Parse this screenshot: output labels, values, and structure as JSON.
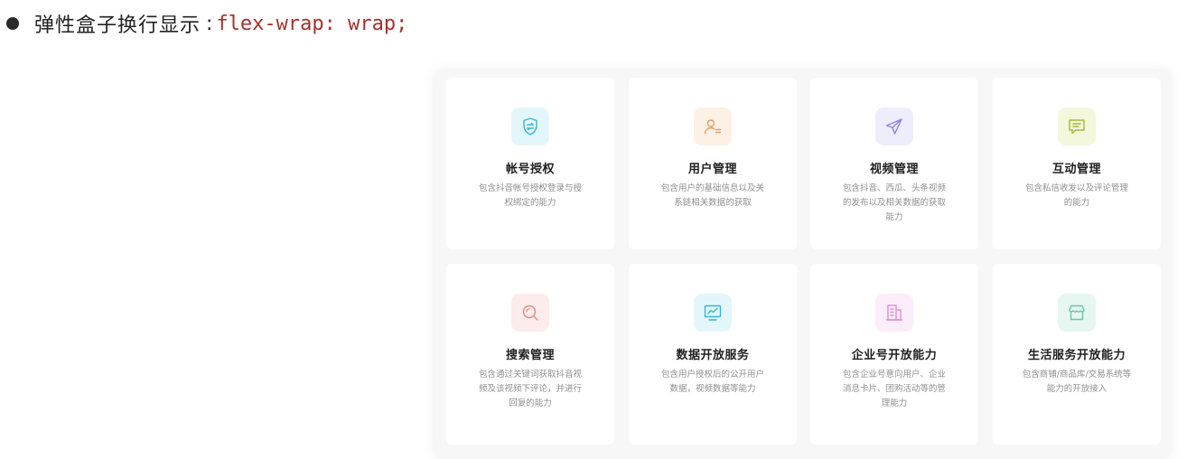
{
  "heading": {
    "title": "弹性盒子换行显示",
    "colon": ":",
    "code": "flex-wrap: wrap;"
  },
  "cards": [
    {
      "title": "帐号授权",
      "desc": "包含抖音帐号授权登录与授权绑定的能力",
      "icon": "shield-swap-icon",
      "color": "#35b6d4",
      "bg": "#e3f7fb"
    },
    {
      "title": "用户管理",
      "desc": "包含用户的基础信息以及关系链相关数据的获取",
      "icon": "user-list-icon",
      "color": "#e0a06b",
      "bg": "#fdf0e4"
    },
    {
      "title": "视频管理",
      "desc": "包含抖音、西瓜、头条视频的发布以及相关数据的获取能力",
      "icon": "paper-plane-icon",
      "color": "#8b86e0",
      "bg": "#eeedfc"
    },
    {
      "title": "互动管理",
      "desc": "包含私信收发以及评论管理的能力",
      "icon": "chat-icon",
      "color": "#a8b836",
      "bg": "#f3f7dc"
    },
    {
      "title": "搜索管理",
      "desc": "包含通过关键词获取抖音视频及该视频下评论，并进行回复的能力",
      "icon": "search-icon",
      "color": "#e58a85",
      "bg": "#fdeceb"
    },
    {
      "title": "数据开放服务",
      "desc": "包含用户授权后的公开用户数据，视频数据等能力",
      "icon": "chart-monitor-icon",
      "color": "#35b6d4",
      "bg": "#e3f7fb"
    },
    {
      "title": "企业号开放能力",
      "desc": "包含企业号意向用户、企业消息卡片、团购活动等的管理能力",
      "icon": "building-icon",
      "color": "#dd8fd8",
      "bg": "#fcedfb"
    },
    {
      "title": "生活服务开放能力",
      "desc": "包含商铺/商品库/交易系统等能力的开放接入",
      "icon": "store-icon",
      "color": "#6cc4a8",
      "bg": "#e6f6f0"
    }
  ]
}
